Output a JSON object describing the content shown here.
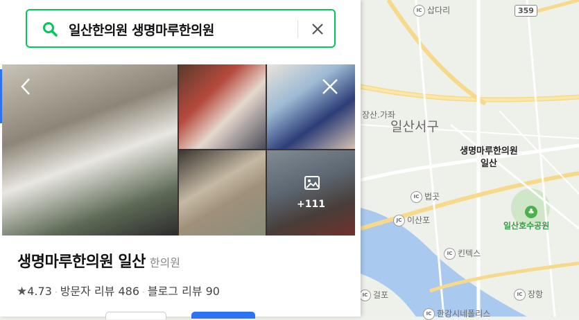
{
  "search": {
    "query": "일산한의원 생명마루한의원"
  },
  "gallery": {
    "more_count": "+111"
  },
  "place": {
    "name": "생명마루한의원 일산",
    "category": "한의원",
    "rating": "4.73",
    "visitor_reviews": "방문자 리뷰 486",
    "blog_reviews": "블로그 리뷰 90"
  },
  "map": {
    "poi_name": "생명마루한의원",
    "poi_sub": "일산",
    "district": "일산서구",
    "place_jangsan": "장산.가좌",
    "park": "일산호수공원",
    "road_number": "359",
    "ic_labels": [
      "삽다리",
      "법곳",
      "이산포",
      "킨텍스",
      "걸포",
      "장항",
      "한강시네폴리스"
    ],
    "marker_color": "#f04a3e",
    "brand_color": "#03c75a"
  }
}
